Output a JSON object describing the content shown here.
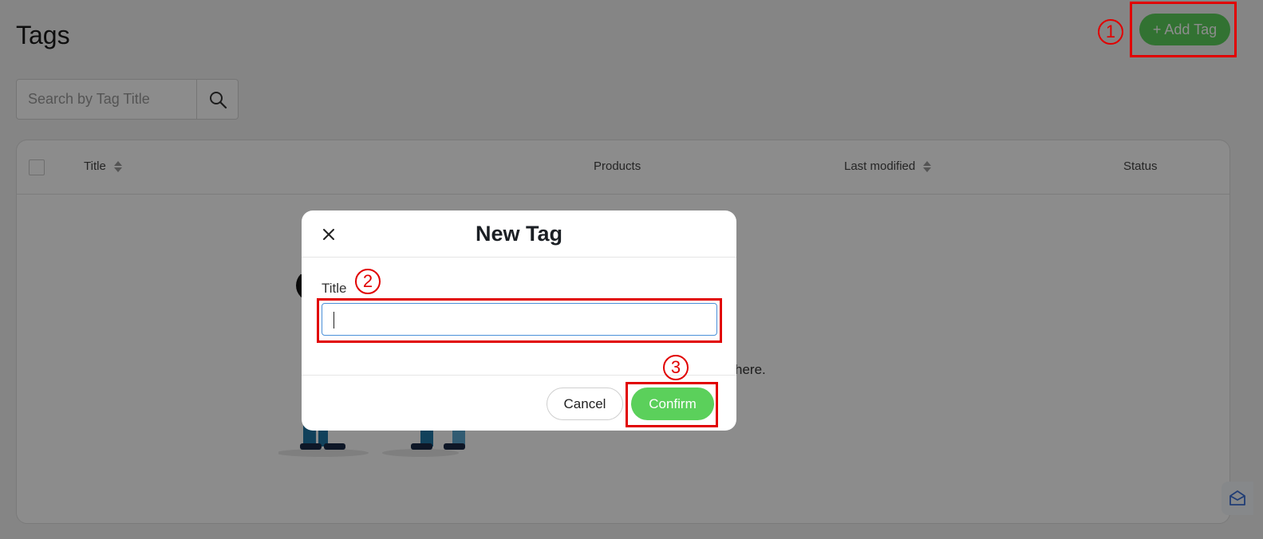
{
  "page": {
    "title": "Tags",
    "add_tag_label": "+ Add Tag",
    "search_placeholder": "Search by Tag Title"
  },
  "table": {
    "columns": [
      "Title",
      "Products",
      "Last modified",
      "Status"
    ],
    "empty_text_visible": "here."
  },
  "modal": {
    "title": "New Tag",
    "field_label": "Title",
    "field_value": "",
    "cancel_label": "Cancel",
    "confirm_label": "Confirm"
  },
  "annotations": [
    "1",
    "2",
    "3"
  ],
  "colors": {
    "accent_green": "#5bd05b",
    "annotation_red": "#e10000",
    "input_focus": "#4a90d9"
  },
  "icons": [
    "search-icon",
    "close-icon",
    "sort-icon",
    "checkbox-icon",
    "mail-icon"
  ]
}
